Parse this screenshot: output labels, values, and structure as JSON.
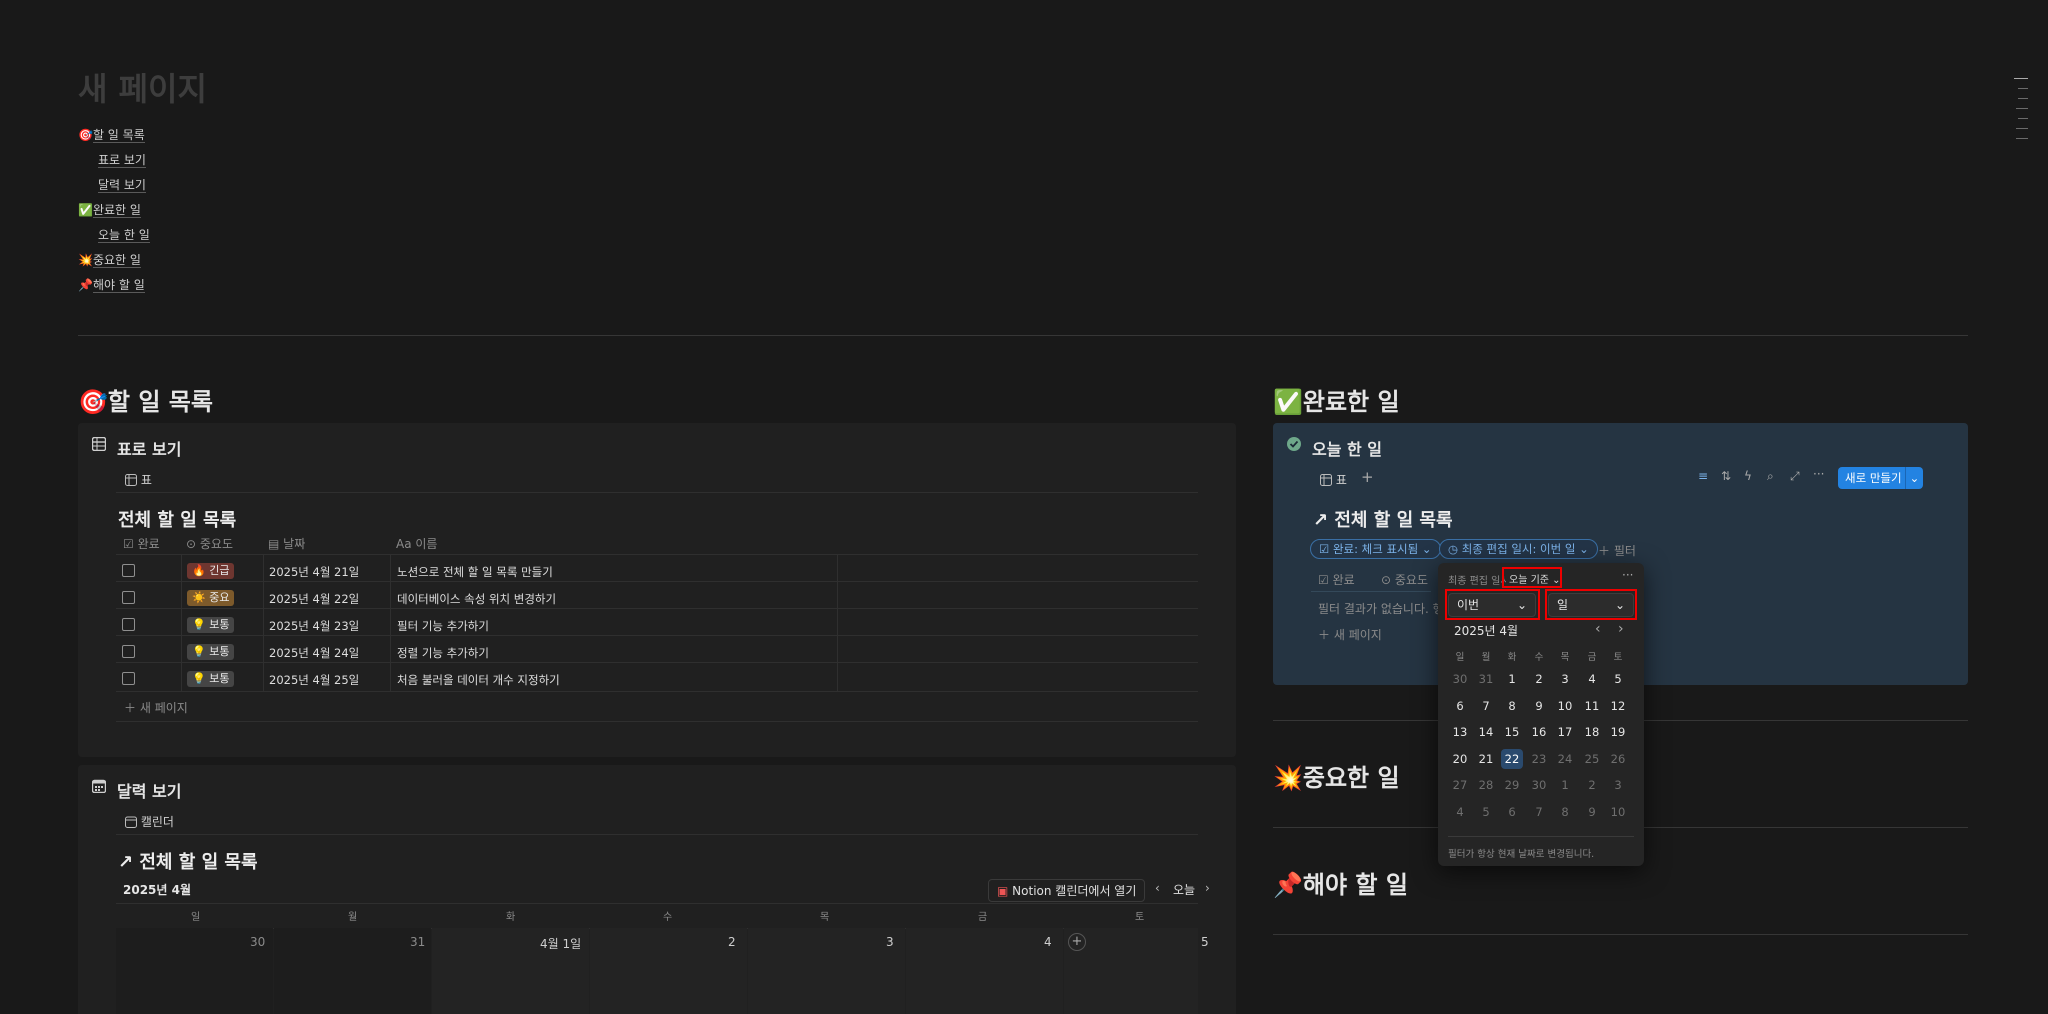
{
  "page": {
    "title": "새 페이지",
    "toc": [
      {
        "icon": "🎯",
        "label": "할 일 목록"
      },
      {
        "icon": "",
        "label": "표로 보기"
      },
      {
        "icon": "",
        "label": "달력 보기"
      },
      {
        "icon": "✅",
        "label": "완료한 일"
      },
      {
        "icon": "",
        "label": "오늘 한 일"
      },
      {
        "icon": "💥",
        "label": "중요한 일"
      },
      {
        "icon": "📌",
        "label": "해야 할 일"
      }
    ]
  },
  "left": {
    "heading": "할 일 목록",
    "heading_icon": "🎯",
    "table_view": {
      "title": "표로 보기",
      "tab_label": "표",
      "db_title": "전체 할 일 목록",
      "columns": [
        "완료",
        "중요도",
        "날짜",
        "Aa",
        "이름"
      ],
      "rows": [
        {
          "tag": "🔥 긴급",
          "tag_color": "#6e3630",
          "date": "2025년 4월 21일",
          "name": "노션으로 전체 할 일 목록 만들기"
        },
        {
          "tag": "☀️ 중요",
          "tag_color": "#7d5a2b",
          "date": "2025년 4월 22일",
          "name": "데이터베이스 속성 위치 변경하기"
        },
        {
          "tag": "💡 보통",
          "tag_color": "#454545",
          "date": "2025년 4월 23일",
          "name": "필터 기능 추가하기"
        },
        {
          "tag": "💡 보통",
          "tag_color": "#454545",
          "date": "2025년 4월 24일",
          "name": "정렬 기능 추가하기"
        },
        {
          "tag": "💡 보통",
          "tag_color": "#454545",
          "date": "2025년 4월 25일",
          "name": "처음 불러올 데이터 개수 지정하기"
        }
      ],
      "new_page": "새 페이지"
    },
    "calendar_view": {
      "title": "달력 보기",
      "tab_label": "캘린더",
      "db_title": "전체 할 일 목록",
      "month": "2025년 4월",
      "open_notion_calendar": "Notion 캘린더에서 열기",
      "today": "오늘",
      "weekdays": [
        "일",
        "월",
        "화",
        "수",
        "목",
        "금",
        "토"
      ],
      "dates": [
        "30",
        "31",
        "4월 1일",
        "2",
        "3",
        "4",
        "5"
      ]
    }
  },
  "right": {
    "heading": "완료한 일",
    "heading_icon": "✅",
    "view": {
      "title": "오늘 한 일",
      "tab_label": "표",
      "new_button": "새로 만들기",
      "db_title": "전체 할 일 목록",
      "filters": {
        "done": "완료: 체크 표시됨",
        "edited": "최종 편집 일시: 이번 일",
        "add": "필터"
      },
      "columns": [
        "완료",
        "중요도"
      ],
      "empty_text": "필터 결과가 없습니다. 행을",
      "new_page": "새 페이지"
    },
    "important_heading": "중요한 일",
    "important_icon": "💥",
    "todo_heading": "해야 할 일",
    "todo_icon": "📌"
  },
  "popup": {
    "prop_label": "최종 편집 일시",
    "basis": "오늘 기준",
    "relative_select": "이번",
    "unit_select": "일",
    "month_label": "2025년 4월",
    "weekdays": [
      "일",
      "월",
      "화",
      "수",
      "목",
      "금",
      "토"
    ],
    "weeks": [
      [
        "30",
        "31",
        "1",
        "2",
        "3",
        "4",
        "5"
      ],
      [
        "6",
        "7",
        "8",
        "9",
        "10",
        "11",
        "12"
      ],
      [
        "13",
        "14",
        "15",
        "16",
        "17",
        "18",
        "19"
      ],
      [
        "20",
        "21",
        "22",
        "23",
        "24",
        "25",
        "26"
      ],
      [
        "27",
        "28",
        "29",
        "30",
        "1",
        "2",
        "3"
      ],
      [
        "4",
        "5",
        "6",
        "7",
        "8",
        "9",
        "10"
      ]
    ],
    "selected": "22",
    "footer": "필터가 항상 현재 날짜로 변경됩니다."
  },
  "colors": {
    "accent": "#2383e2",
    "bg": "#191919",
    "panel": "#202020",
    "blue_panel": "#253442"
  }
}
